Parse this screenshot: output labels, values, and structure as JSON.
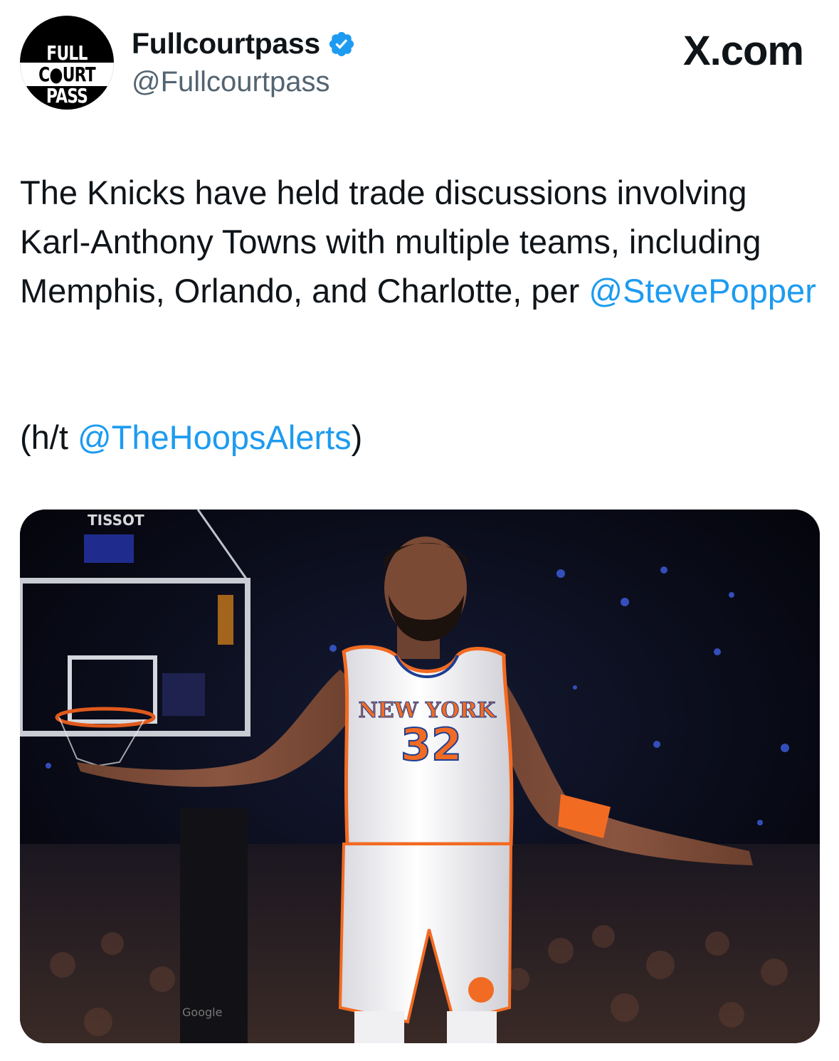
{
  "author": {
    "avatar_text": [
      "FULL",
      "C●URT",
      "PASS"
    ],
    "display_name": "Fullcourtpass",
    "handle": "@Fullcourtpass",
    "verified": true
  },
  "brand": "X.com",
  "tweet": {
    "text_before_mention": "The Knicks have held trade discussions involving Karl-Anthony Towns with multiple teams, including Memphis, Orlando, and Charlotte, per ",
    "mention1": "@StevePopper",
    "ht_prefix": "(h/t ",
    "mention2": "@TheHoopsAlerts",
    "ht_suffix": ")"
  },
  "media": {
    "jersey_wordmark": "NEW YORK",
    "jersey_number": "32",
    "arena_sign": "TISSOT",
    "court_sign": "Google"
  },
  "colors": {
    "link": "#1d9bf0",
    "verified": "#1d9bf0",
    "knicks_orange": "#f26b23",
    "knicks_blue": "#1d3f94"
  }
}
